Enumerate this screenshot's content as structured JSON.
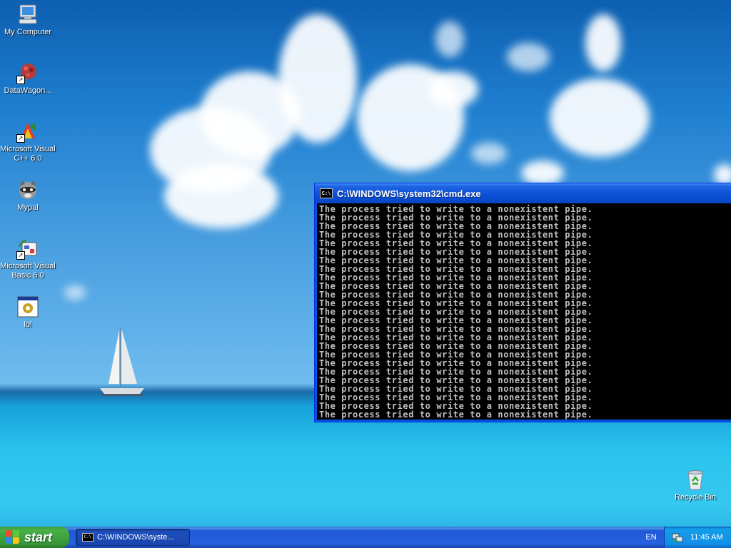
{
  "desktop": {
    "icons": [
      {
        "label": "My Computer",
        "icon": "computer-icon"
      },
      {
        "label": "DataWagon...",
        "icon": "datawagon-icon"
      },
      {
        "label": "Microsoft Visual C++ 6.0",
        "icon": "visual-cpp-icon"
      },
      {
        "label": "Mypal",
        "icon": "mypal-raccoon-icon"
      },
      {
        "label": "Microsoft Visual Basic 6.0",
        "icon": "visual-basic-icon"
      },
      {
        "label": "lol",
        "icon": "lol-program-icon"
      }
    ],
    "recycle_bin": {
      "label": "Recycle Bin",
      "icon": "recycle-bin-icon"
    }
  },
  "cmd_window": {
    "title": "C:\\WINDOWS\\system32\\cmd.exe",
    "icon_text": "C:\\",
    "lines": [
      "The process tried to write to a nonexistent pipe.",
      "The process tried to write to a nonexistent pipe.",
      "The process tried to write to a nonexistent pipe.",
      "The process tried to write to a nonexistent pipe.",
      "The process tried to write to a nonexistent pipe.",
      "The process tried to write to a nonexistent pipe.",
      "The process tried to write to a nonexistent pipe.",
      "The process tried to write to a nonexistent pipe.",
      "The process tried to write to a nonexistent pipe.",
      "The process tried to write to a nonexistent pipe.",
      "The process tried to write to a nonexistent pipe.",
      "The process tried to write to a nonexistent pipe.",
      "The process tried to write to a nonexistent pipe.",
      "The process tried to write to a nonexistent pipe.",
      "The process tried to write to a nonexistent pipe.",
      "The process tried to write to a nonexistent pipe.",
      "The process tried to write to a nonexistent pipe.",
      "The process tried to write to a nonexistent pipe.",
      "The process tried to write to a nonexistent pipe.",
      "The process tried to write to a nonexistent pipe.",
      "The process tried to write to a nonexistent pipe.",
      "The process tried to write to a nonexistent pipe.",
      "The process tried to write to a nonexistent pipe.",
      "The process tried to write to a nonexistent pipe.",
      "The process tried to write to a nonexistent pipe."
    ]
  },
  "taskbar": {
    "start_label": "start",
    "task_button_label": "C:\\WINDOWS\\syste...",
    "task_icon_text": "C:\\",
    "language": "EN",
    "clock": "11:45 AM"
  },
  "colors": {
    "taskbar_blue": "#245edb",
    "start_green": "#3c9a3c",
    "console_bg": "#000000",
    "console_text": "#c0c0c0"
  }
}
